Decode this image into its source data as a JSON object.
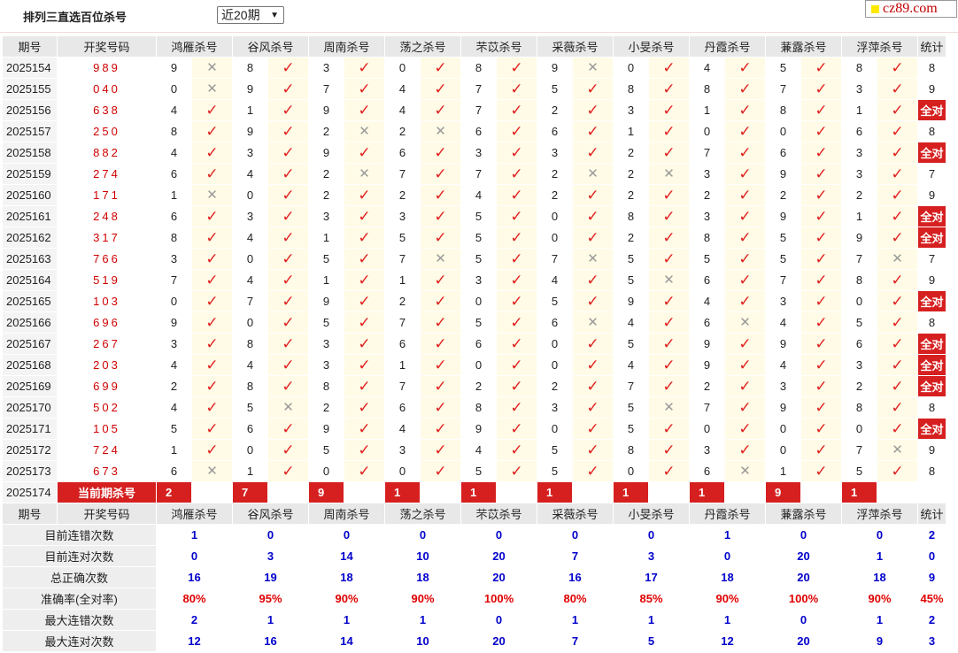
{
  "header": {
    "title": "排列三直选百位杀号",
    "period_select": "近20期",
    "logo": "cz89.com"
  },
  "columns": {
    "issue": "期号",
    "draw": "开奖号码",
    "experts": [
      "鸿雁杀号",
      "谷风杀号",
      "周南杀号",
      "荡之杀号",
      "芣苡杀号",
      "采薇杀号",
      "小旻杀号",
      "丹霞杀号",
      "蒹露杀号",
      "浮萍杀号"
    ],
    "stat": "统计"
  },
  "rows": [
    {
      "issue": "2025154",
      "draw": "989",
      "kills": [
        "9",
        "8",
        "3",
        "0",
        "8",
        "9",
        "0",
        "4",
        "5",
        "8"
      ],
      "results": [
        "x",
        "v",
        "v",
        "v",
        "v",
        "x",
        "v",
        "v",
        "v",
        "v"
      ],
      "stat": "8"
    },
    {
      "issue": "2025155",
      "draw": "040",
      "kills": [
        "0",
        "9",
        "7",
        "4",
        "7",
        "5",
        "8",
        "8",
        "7",
        "3"
      ],
      "results": [
        "x",
        "v",
        "v",
        "v",
        "v",
        "v",
        "v",
        "v",
        "v",
        "v"
      ],
      "stat": "9"
    },
    {
      "issue": "2025156",
      "draw": "638",
      "kills": [
        "4",
        "1",
        "9",
        "4",
        "7",
        "2",
        "3",
        "1",
        "8",
        "1"
      ],
      "results": [
        "v",
        "v",
        "v",
        "v",
        "v",
        "v",
        "v",
        "v",
        "v",
        "v"
      ],
      "stat": "全对"
    },
    {
      "issue": "2025157",
      "draw": "250",
      "kills": [
        "8",
        "9",
        "2",
        "2",
        "6",
        "6",
        "1",
        "0",
        "0",
        "6"
      ],
      "results": [
        "v",
        "v",
        "x",
        "x",
        "v",
        "v",
        "v",
        "v",
        "v",
        "v"
      ],
      "stat": "8"
    },
    {
      "issue": "2025158",
      "draw": "882",
      "kills": [
        "4",
        "3",
        "9",
        "6",
        "3",
        "3",
        "2",
        "7",
        "6",
        "3"
      ],
      "results": [
        "v",
        "v",
        "v",
        "v",
        "v",
        "v",
        "v",
        "v",
        "v",
        "v"
      ],
      "stat": "全对"
    },
    {
      "issue": "2025159",
      "draw": "274",
      "kills": [
        "6",
        "4",
        "2",
        "7",
        "7",
        "2",
        "2",
        "3",
        "9",
        "3"
      ],
      "results": [
        "v",
        "v",
        "x",
        "v",
        "v",
        "x",
        "x",
        "v",
        "v",
        "v"
      ],
      "stat": "7"
    },
    {
      "issue": "2025160",
      "draw": "171",
      "kills": [
        "1",
        "0",
        "2",
        "2",
        "4",
        "2",
        "2",
        "2",
        "2",
        "2"
      ],
      "results": [
        "x",
        "v",
        "v",
        "v",
        "v",
        "v",
        "v",
        "v",
        "v",
        "v"
      ],
      "stat": "9"
    },
    {
      "issue": "2025161",
      "draw": "248",
      "kills": [
        "6",
        "3",
        "3",
        "3",
        "5",
        "0",
        "8",
        "3",
        "9",
        "1"
      ],
      "results": [
        "v",
        "v",
        "v",
        "v",
        "v",
        "v",
        "v",
        "v",
        "v",
        "v"
      ],
      "stat": "全对"
    },
    {
      "issue": "2025162",
      "draw": "317",
      "kills": [
        "8",
        "4",
        "1",
        "5",
        "5",
        "0",
        "2",
        "8",
        "5",
        "9"
      ],
      "results": [
        "v",
        "v",
        "v",
        "v",
        "v",
        "v",
        "v",
        "v",
        "v",
        "v"
      ],
      "stat": "全对"
    },
    {
      "issue": "2025163",
      "draw": "766",
      "kills": [
        "3",
        "0",
        "5",
        "7",
        "5",
        "7",
        "5",
        "5",
        "5",
        "7"
      ],
      "results": [
        "v",
        "v",
        "v",
        "x",
        "v",
        "x",
        "v",
        "v",
        "v",
        "x"
      ],
      "stat": "7"
    },
    {
      "issue": "2025164",
      "draw": "519",
      "kills": [
        "7",
        "4",
        "1",
        "1",
        "3",
        "4",
        "5",
        "6",
        "7",
        "8"
      ],
      "results": [
        "v",
        "v",
        "v",
        "v",
        "v",
        "v",
        "x",
        "v",
        "v",
        "v"
      ],
      "stat": "9"
    },
    {
      "issue": "2025165",
      "draw": "103",
      "kills": [
        "0",
        "7",
        "9",
        "2",
        "0",
        "5",
        "9",
        "4",
        "3",
        "0"
      ],
      "results": [
        "v",
        "v",
        "v",
        "v",
        "v",
        "v",
        "v",
        "v",
        "v",
        "v"
      ],
      "stat": "全对"
    },
    {
      "issue": "2025166",
      "draw": "696",
      "kills": [
        "9",
        "0",
        "5",
        "7",
        "5",
        "6",
        "4",
        "6",
        "4",
        "5"
      ],
      "results": [
        "v",
        "v",
        "v",
        "v",
        "v",
        "x",
        "v",
        "x",
        "v",
        "v"
      ],
      "stat": "8"
    },
    {
      "issue": "2025167",
      "draw": "267",
      "kills": [
        "3",
        "8",
        "3",
        "6",
        "6",
        "0",
        "5",
        "9",
        "9",
        "6"
      ],
      "results": [
        "v",
        "v",
        "v",
        "v",
        "v",
        "v",
        "v",
        "v",
        "v",
        "v"
      ],
      "stat": "全对"
    },
    {
      "issue": "2025168",
      "draw": "203",
      "kills": [
        "4",
        "4",
        "3",
        "1",
        "0",
        "0",
        "4",
        "9",
        "4",
        "3"
      ],
      "results": [
        "v",
        "v",
        "v",
        "v",
        "v",
        "v",
        "v",
        "v",
        "v",
        "v"
      ],
      "stat": "全对"
    },
    {
      "issue": "2025169",
      "draw": "699",
      "kills": [
        "2",
        "8",
        "8",
        "7",
        "2",
        "2",
        "7",
        "2",
        "3",
        "2"
      ],
      "results": [
        "v",
        "v",
        "v",
        "v",
        "v",
        "v",
        "v",
        "v",
        "v",
        "v"
      ],
      "stat": "全对"
    },
    {
      "issue": "2025170",
      "draw": "502",
      "kills": [
        "4",
        "5",
        "2",
        "6",
        "8",
        "3",
        "5",
        "7",
        "9",
        "8"
      ],
      "results": [
        "v",
        "x",
        "v",
        "v",
        "v",
        "v",
        "x",
        "v",
        "v",
        "v"
      ],
      "stat": "8"
    },
    {
      "issue": "2025171",
      "draw": "105",
      "kills": [
        "5",
        "6",
        "9",
        "4",
        "9",
        "0",
        "5",
        "0",
        "0",
        "0"
      ],
      "results": [
        "v",
        "v",
        "v",
        "v",
        "v",
        "v",
        "v",
        "v",
        "v",
        "v"
      ],
      "stat": "全对"
    },
    {
      "issue": "2025172",
      "draw": "724",
      "kills": [
        "1",
        "0",
        "5",
        "3",
        "4",
        "5",
        "8",
        "3",
        "0",
        "7"
      ],
      "results": [
        "v",
        "v",
        "v",
        "v",
        "v",
        "v",
        "v",
        "v",
        "v",
        "x"
      ],
      "stat": "9"
    },
    {
      "issue": "2025173",
      "draw": "673",
      "kills": [
        "6",
        "1",
        "0",
        "0",
        "5",
        "5",
        "0",
        "6",
        "1",
        "5"
      ],
      "results": [
        "x",
        "v",
        "v",
        "v",
        "v",
        "v",
        "v",
        "x",
        "v",
        "v"
      ],
      "stat": "8"
    }
  ],
  "current": {
    "issue": "2025174",
    "label": "当前期杀号",
    "kills": [
      "2",
      "7",
      "9",
      "1",
      "1",
      "1",
      "1",
      "1",
      "9",
      "1"
    ]
  },
  "summary": [
    {
      "label": "目前连错次数",
      "values": [
        "1",
        "0",
        "0",
        "0",
        "0",
        "0",
        "0",
        "1",
        "0",
        "0"
      ],
      "stat": "2"
    },
    {
      "label": "目前连对次数",
      "values": [
        "0",
        "3",
        "14",
        "10",
        "20",
        "7",
        "3",
        "0",
        "20",
        "1"
      ],
      "stat": "0"
    },
    {
      "label": "总正确次数",
      "values": [
        "16",
        "19",
        "18",
        "18",
        "20",
        "16",
        "17",
        "18",
        "20",
        "18"
      ],
      "stat": "9"
    },
    {
      "label": "准确率(全对率)",
      "values": [
        "80%",
        "95%",
        "90%",
        "90%",
        "100%",
        "80%",
        "85%",
        "90%",
        "100%",
        "90%"
      ],
      "stat": "45%"
    },
    {
      "label": "最大连错次数",
      "values": [
        "2",
        "1",
        "1",
        "1",
        "0",
        "1",
        "1",
        "1",
        "0",
        "1"
      ],
      "stat": "2"
    },
    {
      "label": "最大连对次数",
      "values": [
        "12",
        "16",
        "14",
        "10",
        "20",
        "7",
        "5",
        "12",
        "20",
        "9"
      ],
      "stat": "3"
    }
  ],
  "colors": {
    "accent": "#d62020",
    "draw_red": "#d00000",
    "check": "#e02020",
    "cross": "#9a9a9a",
    "summary_blue": "#0000cc",
    "mark_bg": "#fffbe6"
  },
  "icons": {
    "check": "check-icon",
    "cross": "cross-icon"
  }
}
